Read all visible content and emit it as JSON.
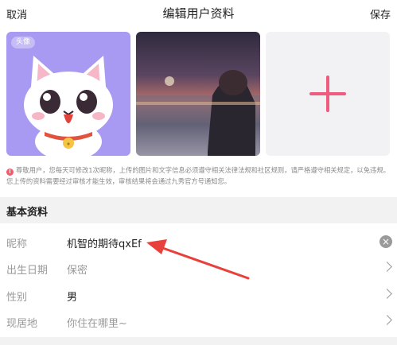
{
  "header": {
    "cancel_label": "取消",
    "title": "编辑用户资料",
    "save_label": "保存"
  },
  "photos": {
    "avatar_badge": "头像",
    "add_photo_icon": "plus-icon",
    "accent_color": "#f05a7e"
  },
  "notice": {
    "text": "尊敬用户，您每天可修改1次昵称，上传的图片和文字信息必须遵守相关法律法规和社区规则，请严格遵守相关规定，以免违规。您上传的资料需要经过审核才能生效，审核结果将会通过九秀官方号通知您。"
  },
  "section": {
    "title": "基本资料"
  },
  "rows": [
    {
      "label": "昵称",
      "value": "机智的期待qxEf",
      "icon": "clear-icon"
    },
    {
      "label": "出生日期",
      "value": "保密",
      "icon": "chevron-right-icon"
    },
    {
      "label": "性别",
      "value": "男",
      "icon": "chevron-right-icon"
    },
    {
      "label": "现居地",
      "value": "你住在哪里~",
      "icon": "chevron-right-icon"
    }
  ],
  "annotation": {
    "color": "#e8413c"
  }
}
